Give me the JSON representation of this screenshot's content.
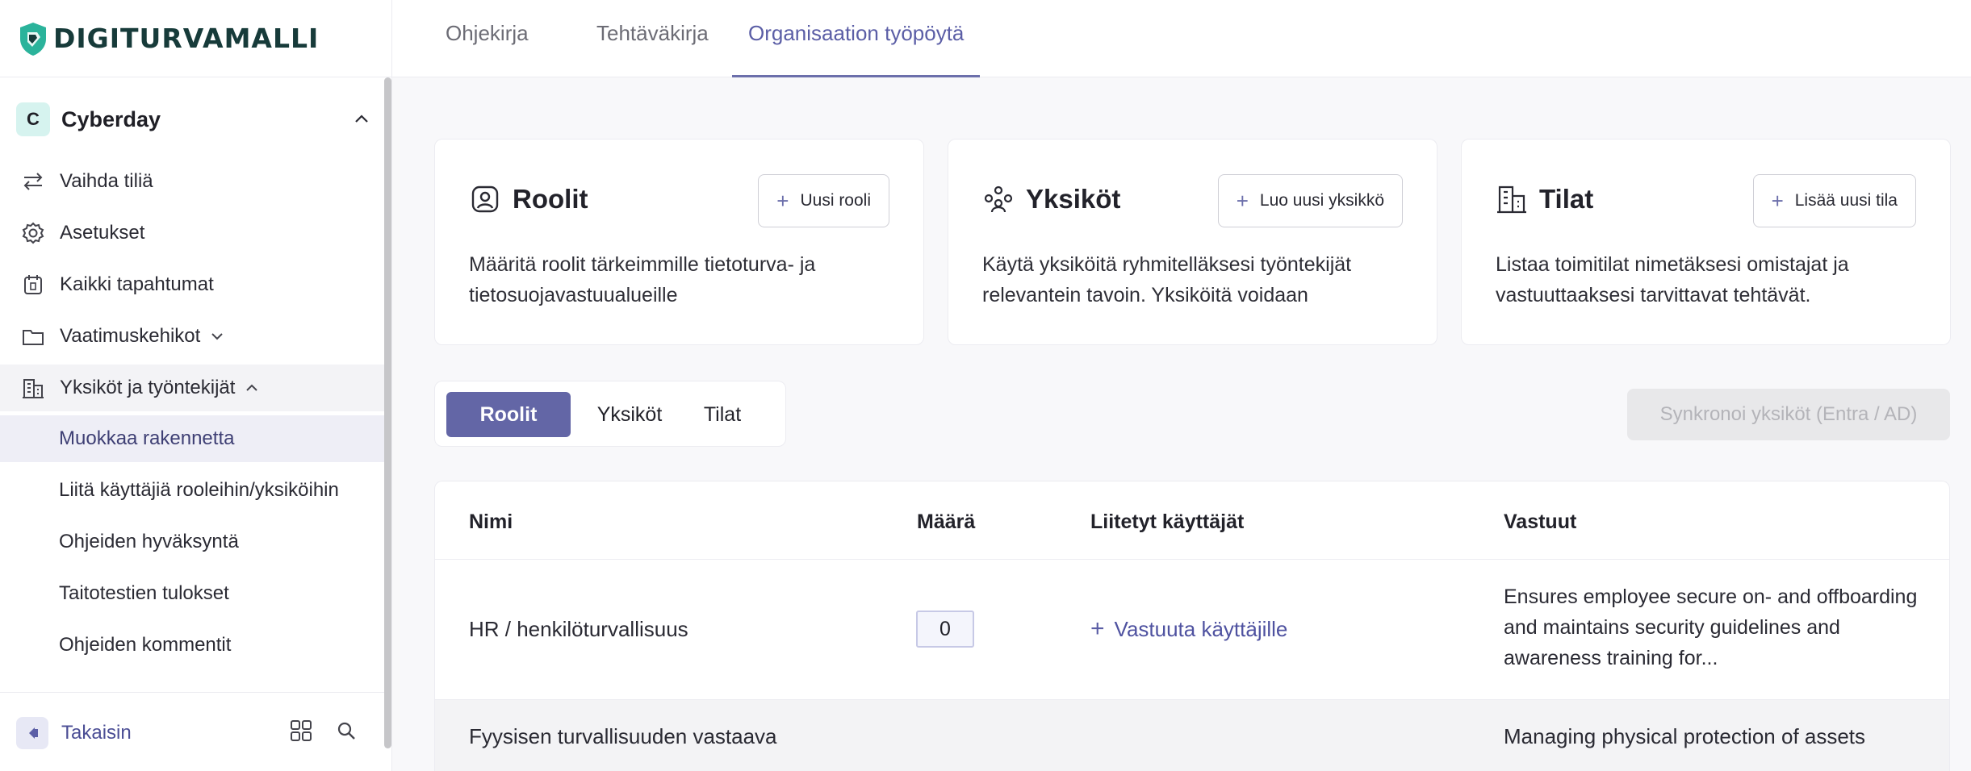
{
  "brand": {
    "name": "DIGITURVAMALLI"
  },
  "topnav": {
    "tabs": [
      "Ohjekirja",
      "Tehtäväkirja",
      "Organisaation työpöytä"
    ],
    "active": 2
  },
  "sidebar": {
    "org": {
      "initial": "C",
      "name": "Cyberday"
    },
    "items": [
      {
        "label": "Vaihda tiliä",
        "icon": "swap-icon"
      },
      {
        "label": "Asetukset",
        "icon": "gear-icon"
      },
      {
        "label": "Kaikki tapahtumat",
        "icon": "calendar-icon"
      },
      {
        "label": "Vaatimuskehikot",
        "icon": "folder-icon"
      },
      {
        "label": "Yksiköt ja työntekijät",
        "icon": "building-icon"
      }
    ],
    "subitems": [
      "Muokkaa rakennetta",
      "Liitä käyttäjiä rooleihin/yksiköihin",
      "Ohjeiden hyväksyntä",
      "Taitotestien tulokset",
      "Ohjeiden kommentit"
    ],
    "back_label": "Takaisin"
  },
  "cards": [
    {
      "title": "Roolit",
      "button": "Uusi rooli",
      "desc": "Määritä roolit tärkeimmille tietoturva- ja tietosuojavastuualueille"
    },
    {
      "title": "Yksiköt",
      "button": "Luo uusi yksikkö",
      "desc": "Käytä yksiköitä ryhmitelläksesi työntekijät relevantein tavoin. Yksiköitä voidaan"
    },
    {
      "title": "Tilat",
      "button": "Lisää uusi tila",
      "desc": "Listaa toimitilat nimetäksesi omistajat ja vastuuttaaksesi tarvittavat tehtävät."
    }
  ],
  "segments": {
    "items": [
      "Roolit",
      "Yksiköt",
      "Tilat"
    ],
    "active": 0
  },
  "sync_button": "Synkronoi yksiköt (Entra / AD)",
  "table": {
    "headers": [
      "Nimi",
      "Määrä",
      "Liitetyt käyttäjät",
      "Vastuut"
    ],
    "rows": [
      {
        "name": "HR / henkilöturvallisuus",
        "count": "0",
        "assign": "Vastuuta käyttäjille",
        "resp": "Ensures employee secure on- and offboarding and maintains security guidelines and awareness training for..."
      },
      {
        "name": "Fyysisen turvallisuuden vastaava",
        "resp": "Managing physical protection of assets"
      }
    ]
  },
  "colors": {
    "accent": "#6366a6",
    "brand_green": "#2bb39b"
  }
}
